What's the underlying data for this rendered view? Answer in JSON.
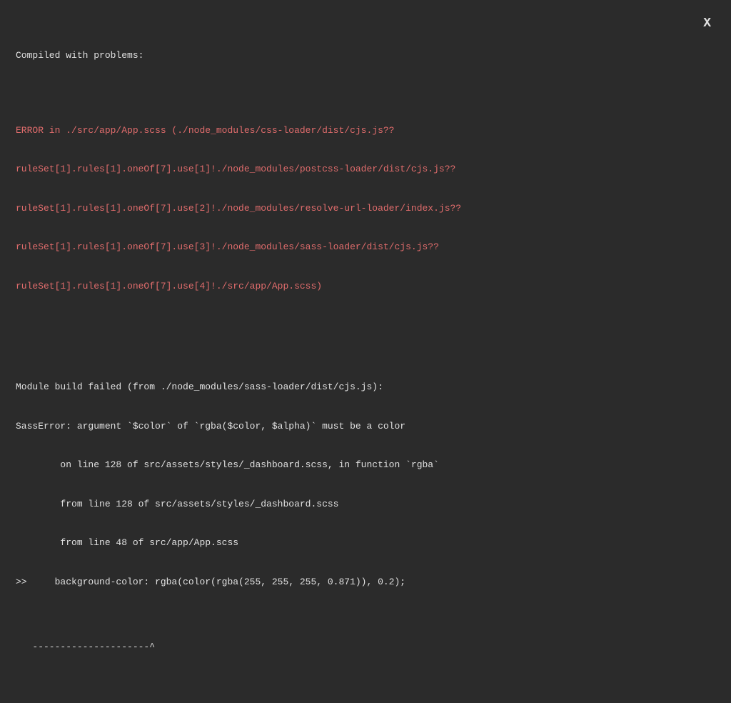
{
  "close_label": "X",
  "heading": "Compiled with problems:",
  "error_path_lines": [
    "ERROR in ./src/app/App.scss (./node_modules/css-loader/dist/cjs.js??",
    "ruleSet[1].rules[1].oneOf[7].use[1]!./node_modules/postcss-loader/dist/cjs.js??",
    "ruleSet[1].rules[1].oneOf[7].use[2]!./node_modules/resolve-url-loader/index.js??",
    "ruleSet[1].rules[1].oneOf[7].use[3]!./node_modules/sass-loader/dist/cjs.js??",
    "ruleSet[1].rules[1].oneOf[7].use[4]!./src/app/App.scss)"
  ],
  "error_body_lines": [
    "Module build failed (from ./node_modules/sass-loader/dist/cjs.js):",
    "SassError: argument `$color` of `rgba($color, $alpha)` must be a color",
    "        on line 128 of src/assets/styles/_dashboard.scss, in function `rgba`",
    "        from line 128 of src/assets/styles/_dashboard.scss",
    "        from line 48 of src/app/App.scss",
    ">>     background-color: rgba(color(rgba(255, 255, 255, 0.871)), 0.2);",
    "",
    "   ---------------------^"
  ]
}
